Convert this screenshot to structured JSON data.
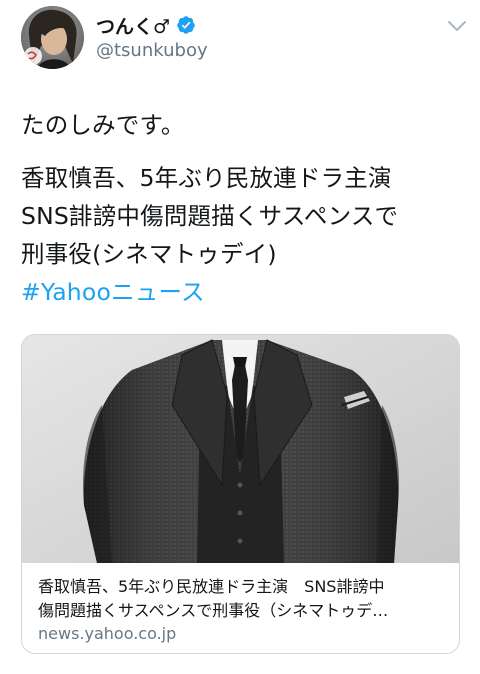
{
  "tweet": {
    "author": {
      "display_name": "つんく♂",
      "handle": "@tsunkuboy",
      "verified": true,
      "avatar_icon": "profile-photo"
    },
    "menu_icon": "chevron-down-icon",
    "text_lines": [
      "たのしみです。",
      "香取慎吾、5年ぶり民放連ドラ主演",
      "SNS誹謗中傷問題描くサスペンスで",
      "刑事役(シネマトゥデイ)"
    ],
    "hashtag": "#Yahooニュース",
    "colors": {
      "link": "#1da1f2",
      "verified": "#1da1f2",
      "secondary_text": "#657786",
      "border": "#ccd6dd"
    }
  },
  "card": {
    "image_icon": "suit-photo",
    "title_lines": [
      "香取慎吾、5年ぶり民放連ドラ主演　SNS誹謗中",
      "傷問題描くサスペンスで刑事役（シネマトゥデ…"
    ],
    "domain": "news.yahoo.co.jp"
  }
}
